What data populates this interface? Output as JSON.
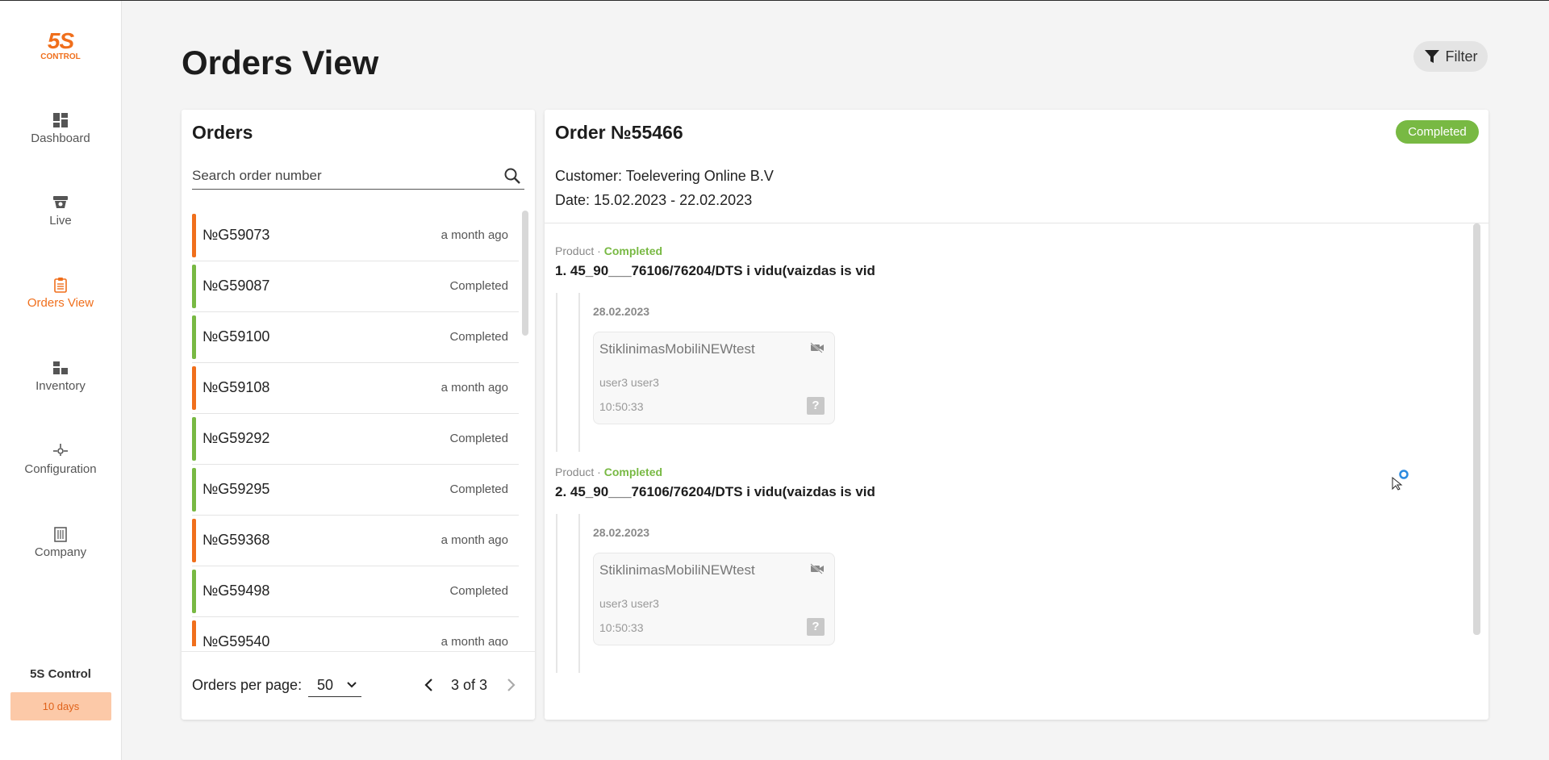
{
  "sidebar": {
    "logo_main": "5S",
    "logo_sub": "CONTROL",
    "items": [
      {
        "label": "Dashboard",
        "icon": "dashboard-icon"
      },
      {
        "label": "Live",
        "icon": "camera-icon"
      },
      {
        "label": "Orders View",
        "icon": "clipboard-icon"
      },
      {
        "label": "Inventory",
        "icon": "inventory-icon"
      },
      {
        "label": "Configuration",
        "icon": "configuration-icon"
      },
      {
        "label": "Company",
        "icon": "building-icon"
      }
    ],
    "brand_label": "5S Control",
    "trial_badge": "10 days"
  },
  "header": {
    "title": "Orders View",
    "filter_label": "Filter"
  },
  "orders": {
    "title": "Orders",
    "search_placeholder": "Search order number",
    "rows": [
      {
        "number": "№G59073",
        "meta": "a month ago",
        "status_color": "#f06f1c"
      },
      {
        "number": "№G59087",
        "meta": "Completed",
        "status_color": "#78b943"
      },
      {
        "number": "№G59100",
        "meta": "Completed",
        "status_color": "#78b943"
      },
      {
        "number": "№G59108",
        "meta": "a month ago",
        "status_color": "#f06f1c"
      },
      {
        "number": "№G59292",
        "meta": "Completed",
        "status_color": "#78b943"
      },
      {
        "number": "№G59295",
        "meta": "Completed",
        "status_color": "#78b943"
      },
      {
        "number": "№G59368",
        "meta": "a month ago",
        "status_color": "#f06f1c"
      },
      {
        "number": "№G59498",
        "meta": "Completed",
        "status_color": "#78b943"
      },
      {
        "number": "№G59540",
        "meta": "a month ago",
        "status_color": "#f06f1c"
      }
    ],
    "per_page_label": "Orders per page:",
    "per_page_value": "50",
    "page_info": "3 of 3"
  },
  "detail": {
    "title": "Order №55466",
    "status": "Completed",
    "customer_label": "Customer:",
    "customer": "Toelevering Online B.V",
    "date_label": "Date:",
    "date_range": "15.02.2023 - 22.02.2023",
    "products": [
      {
        "type_label": "Product",
        "separator": " · ",
        "status": "Completed",
        "name": "1. 45_90___76106/76204/DTS i vidu(vaizdas is vid",
        "date": "28.02.2023",
        "camera": "StiklinimasMobiliNEWtest",
        "user": "user3 user3",
        "time": "10:50:33"
      },
      {
        "type_label": "Product",
        "separator": " · ",
        "status": "Completed",
        "name": "2. 45_90___76106/76204/DTS i vidu(vaizdas is vid",
        "date": "28.02.2023",
        "camera": "StiklinimasMobiliNEWtest",
        "user": "user3 user3",
        "time": "10:50:33"
      }
    ]
  },
  "colors": {
    "accent": "#f06f1c",
    "completed": "#78b943",
    "trial_bg": "#fcc9a8"
  }
}
